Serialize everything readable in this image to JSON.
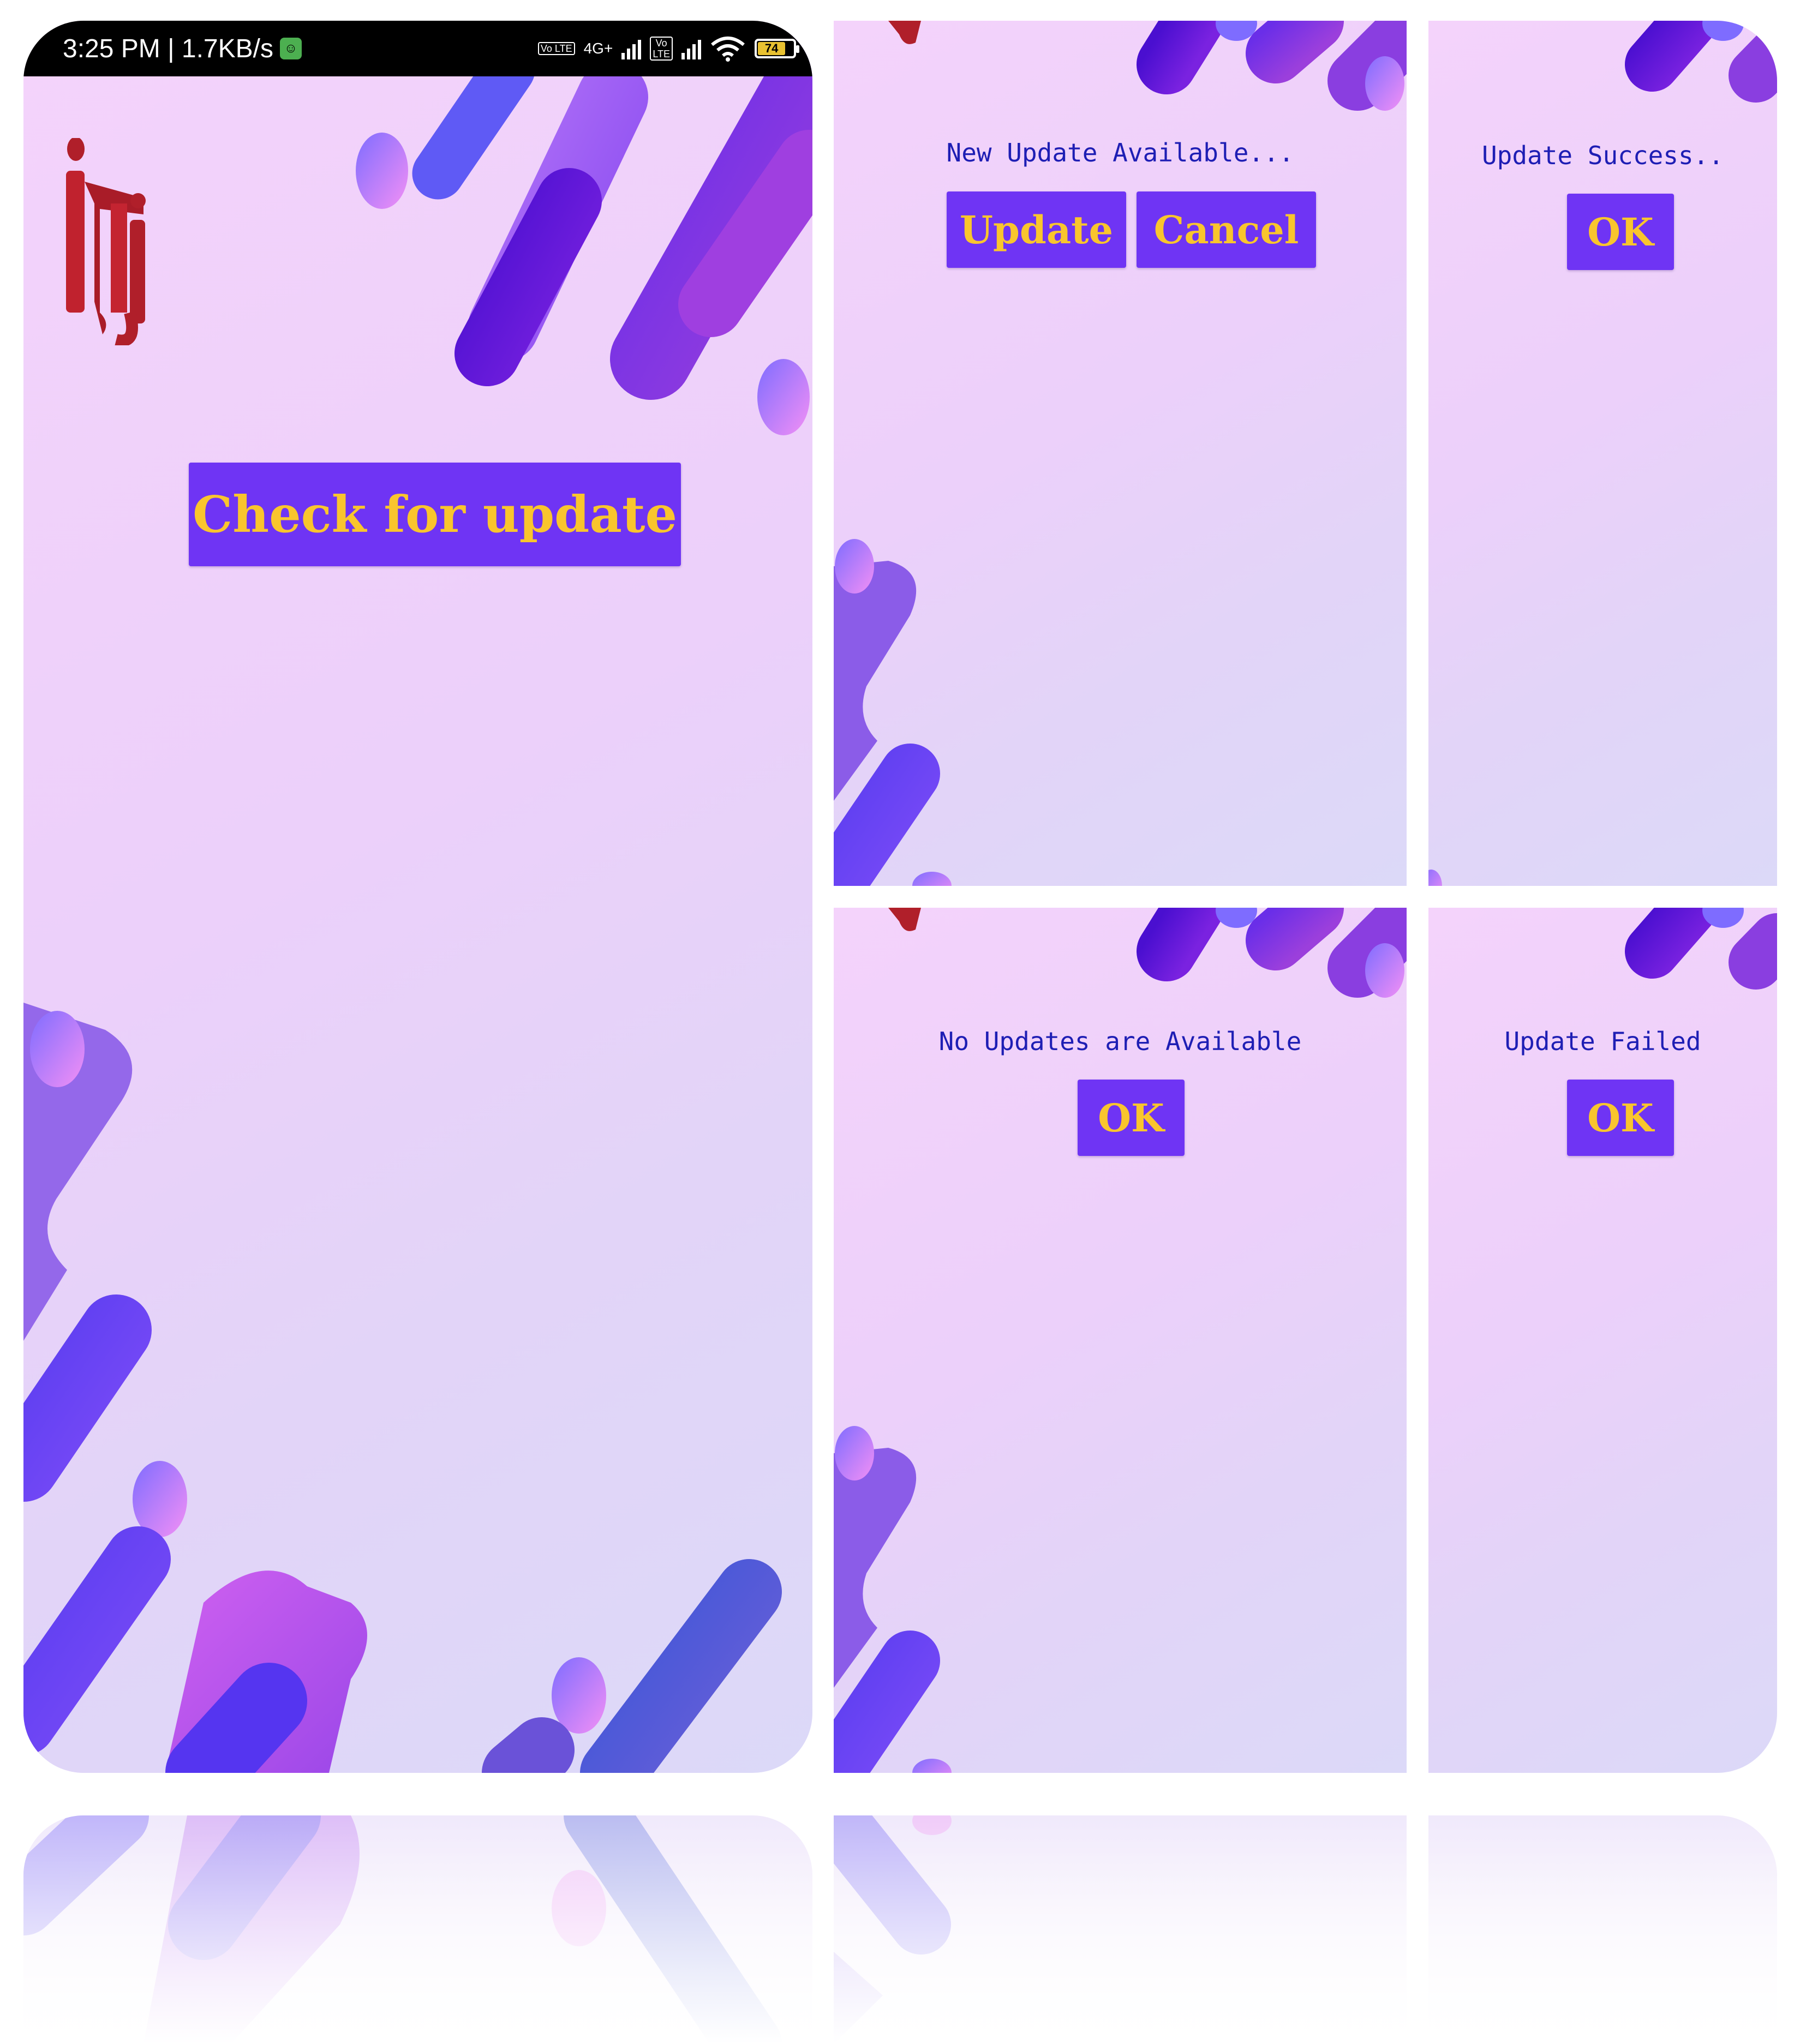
{
  "status_bar": {
    "time_speed": "3:25 PM | 1.7KB/s",
    "network_type": "4G+",
    "volte": "Vo LTE",
    "battery": "74"
  },
  "main_screen": {
    "logo": "iti-logo",
    "check_button": "Check for update"
  },
  "update_dialog": {
    "message": "New Update Available...",
    "update_button": "Update",
    "cancel_button": "Cancel"
  },
  "success_dialog": {
    "message": "Update Success..",
    "ok_button": "OK"
  },
  "no_updates_dialog": {
    "message": "No Updates are Available",
    "ok_button": "OK"
  },
  "failed_dialog": {
    "message": "Update Failed",
    "ok_button": "OK"
  },
  "colors": {
    "button_bg": "#6f34f4",
    "button_text": "#f9c52d",
    "message_text": "#1e1eb4",
    "logo_red": "#b01f2a"
  }
}
